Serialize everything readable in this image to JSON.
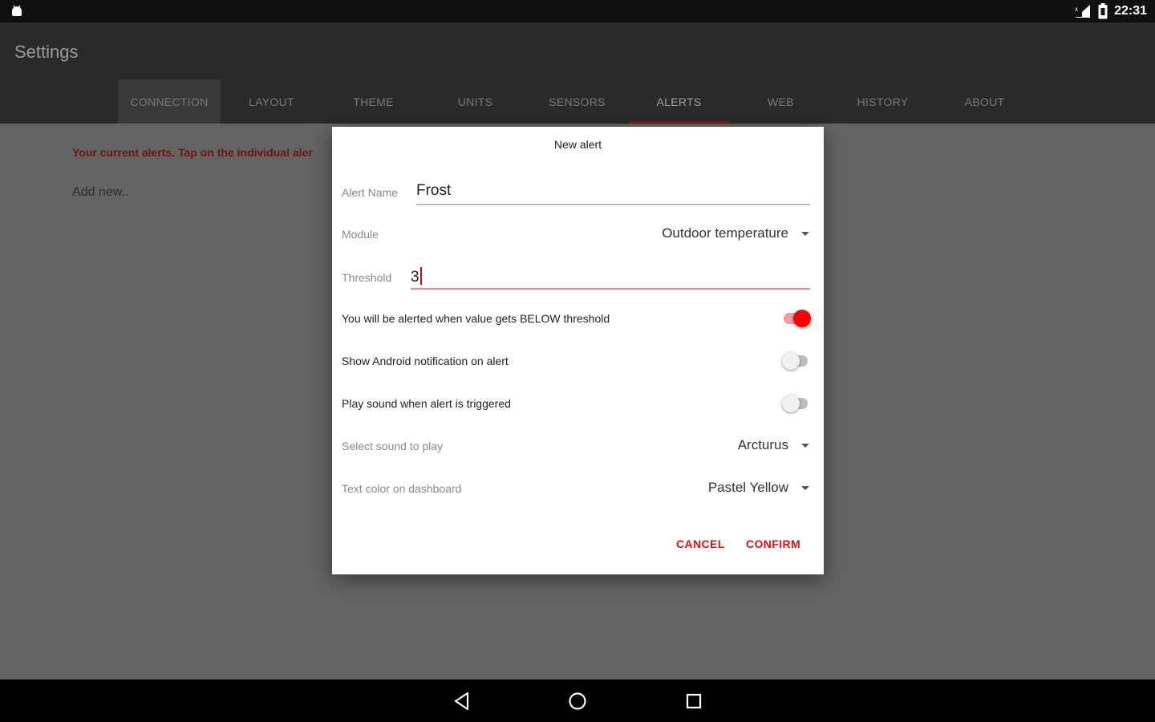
{
  "status_bar": {
    "time": "22:31",
    "icons": [
      "android-icon",
      "signal-icon",
      "battery-icon"
    ]
  },
  "app": {
    "title": "Settings",
    "tabs": [
      {
        "label": "CONNECTION"
      },
      {
        "label": "LAYOUT"
      },
      {
        "label": "THEME"
      },
      {
        "label": "UNITS"
      },
      {
        "label": "SENSORS"
      },
      {
        "label": "ALERTS",
        "active": true
      },
      {
        "label": "WEB"
      },
      {
        "label": "HISTORY"
      },
      {
        "label": "ABOUT"
      }
    ]
  },
  "background": {
    "alerts_hint": "Your current alerts. Tap on the individual aler",
    "add_new": "Add new.."
  },
  "dialog": {
    "title": "New alert",
    "alert_name": {
      "label": "Alert Name",
      "value": "Frost"
    },
    "module": {
      "label": "Module",
      "value": "Outdoor temperature"
    },
    "threshold": {
      "label": "Threshold",
      "value": "3"
    },
    "below_toggle": {
      "label": "You will be alerted when value gets BELOW threshold",
      "on": true
    },
    "notify_toggle": {
      "label": "Show Android notification on alert",
      "on": false
    },
    "sound_toggle": {
      "label": "Play sound when alert is triggered",
      "on": false
    },
    "sound_select": {
      "label": "Select sound to play",
      "value": "Arcturus"
    },
    "text_color": {
      "label": "Text color on dashboard",
      "value": "Pastel Yellow"
    },
    "cancel_label": "CANCEL",
    "confirm_label": "CONFIRM"
  },
  "colors": {
    "accent": "#ff0000",
    "scrim_background": "#646464",
    "status_bar": "#101010",
    "nav_bar": "#000000"
  },
  "nav_bar": {
    "buttons": [
      "back-icon",
      "home-icon",
      "recents-icon"
    ]
  }
}
